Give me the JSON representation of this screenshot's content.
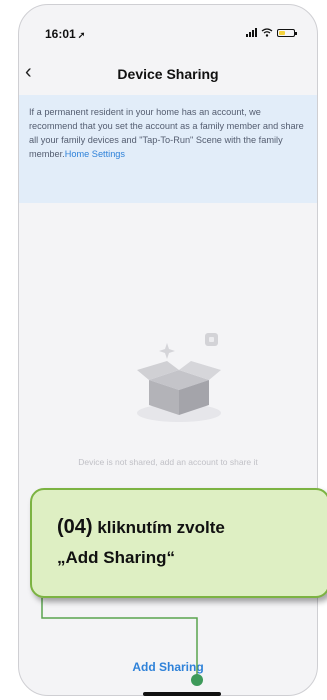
{
  "status": {
    "time": "16:01",
    "battery_level": 0.4
  },
  "nav": {
    "title": "Device Sharing"
  },
  "info": {
    "text": "If a permanent resident in your home has an account, we recommend that you set the account as a family member and share all your family devices and \"Tap-To-Run\" Scene with the family member.",
    "link": "Home Settings"
  },
  "empty": {
    "text": "Device is not shared, add an account to share it"
  },
  "callout": {
    "number": "(04)",
    "line1": "kliknutím zvolte",
    "line2": "„Add Sharing“"
  },
  "bottom": {
    "add_sharing": "Add Sharing"
  },
  "colors": {
    "accent": "#2f82d9",
    "callout_bg": "#deefc3",
    "callout_border": "#7cb342",
    "info_bg": "#e2edf9"
  },
  "icons": [
    "location-arrow-icon",
    "signal-icon",
    "wifi-icon",
    "battery-icon",
    "back-chevron-icon",
    "empty-box-icon"
  ]
}
